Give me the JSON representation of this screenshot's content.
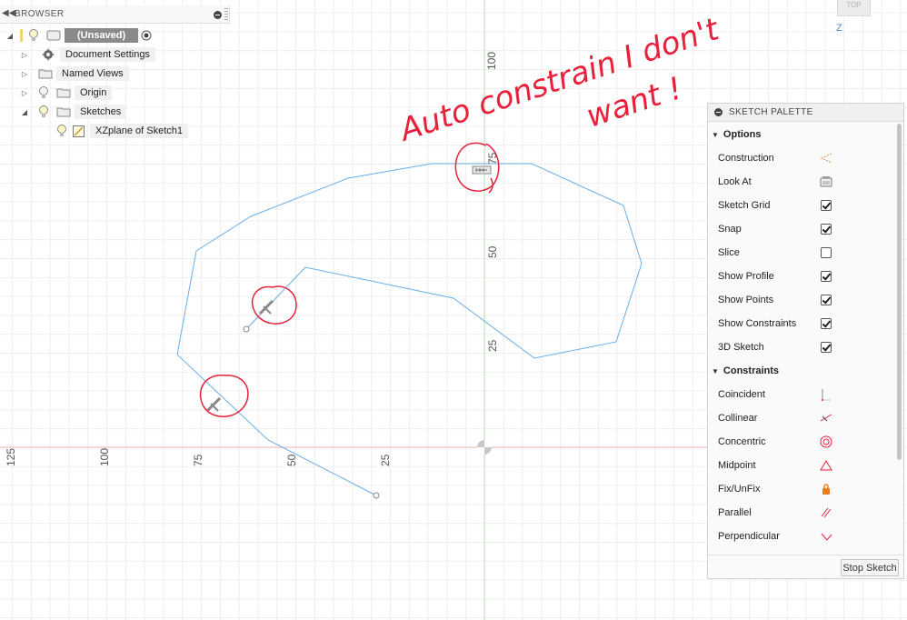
{
  "browser": {
    "title": "BROWSER",
    "root_label": "(Unsaved)",
    "items": [
      {
        "label": "Document Settings"
      },
      {
        "label": "Named Views"
      },
      {
        "label": "Origin"
      },
      {
        "label": "Sketches"
      }
    ],
    "sketch_child": "XZplane of Sketch1"
  },
  "viewcube": {
    "label": "TOP",
    "axis": "Z"
  },
  "axis_ticks": {
    "vertical": [
      "100",
      "75",
      "50",
      "25"
    ],
    "horizontal": [
      "125",
      "100",
      "75",
      "50",
      "25"
    ]
  },
  "annotation": {
    "line1": "Auto constrain I don't",
    "line2": "want !",
    "color": "#e8203a"
  },
  "palette": {
    "title": "SKETCH PALETTE",
    "options_header": "Options",
    "options": [
      {
        "label": "Construction",
        "icon": "construction-icon"
      },
      {
        "label": "Look At",
        "icon": "look-at-icon"
      },
      {
        "label": "Sketch Grid",
        "checked": true
      },
      {
        "label": "Snap",
        "checked": true
      },
      {
        "label": "Slice",
        "checked": false
      },
      {
        "label": "Show Profile",
        "checked": true
      },
      {
        "label": "Show Points",
        "checked": true
      },
      {
        "label": "Show Constraints",
        "checked": true
      },
      {
        "label": "3D Sketch",
        "checked": true
      }
    ],
    "constraints_header": "Constraints",
    "constraints": [
      {
        "label": "Coincident",
        "icon": "coincident-icon"
      },
      {
        "label": "Collinear",
        "icon": "collinear-icon"
      },
      {
        "label": "Concentric",
        "icon": "concentric-icon"
      },
      {
        "label": "Midpoint",
        "icon": "midpoint-icon"
      },
      {
        "label": "Fix/UnFix",
        "icon": "fix-unfix-icon"
      },
      {
        "label": "Parallel",
        "icon": "parallel-icon"
      },
      {
        "label": "Perpendicular",
        "icon": "perpendicular-icon"
      }
    ],
    "stop_button": "Stop Sketch"
  },
  "colors": {
    "sketch_line": "#6aaee8",
    "x_axis": "#f2b8b8",
    "z_axis": "#b9e3b9",
    "constraint_icon": "#e8203a"
  }
}
